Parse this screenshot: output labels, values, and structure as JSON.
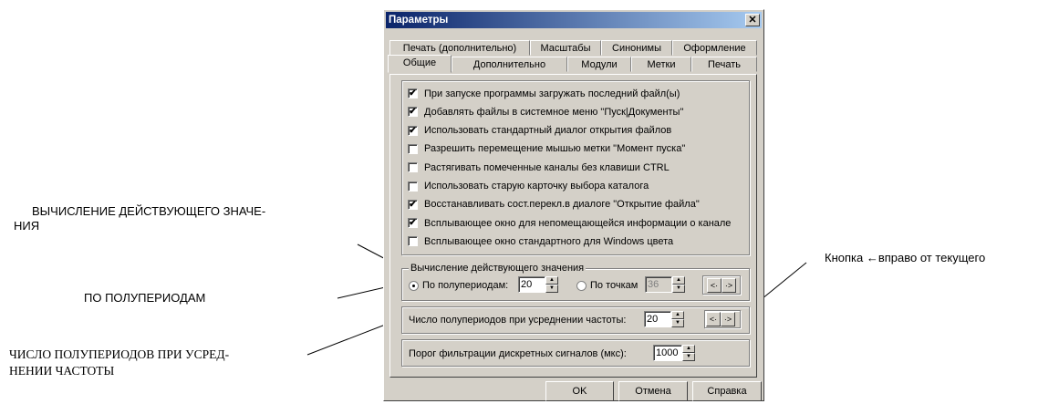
{
  "annotations": {
    "vych_line1": "ВЫЧИСЛЕНИЕ ДЕЙСТВУЮЩЕГО ЗНАЧЕ-",
    "vych_line2": "НИЯ",
    "po_poluperiodam": "ПО ПОЛУПЕРИОДАМ",
    "chislo_line1": "ЧИСЛО ПОЛУПЕРИОДОВ ПРИ УСРЕД-",
    "chislo_line2": "НЕНИИ ЧАСТОТЫ",
    "knopka": "Кнопка ←вправо от текущего"
  },
  "dialog": {
    "title": "Параметры",
    "close": "✕",
    "tabs_row1": [
      "Печать (дополнительно)",
      "Масштабы",
      "Синонимы",
      "Оформление"
    ],
    "tabs_row2": [
      "Общие",
      "Дополнительно",
      "Модули",
      "Метки",
      "Печать"
    ],
    "active_tab": "Общие",
    "checkboxes": [
      {
        "label": "При запуске программы загружать последний файл(ы)",
        "checked": true
      },
      {
        "label": "Добавлять файлы в системное меню \"Пуск|Документы\"",
        "checked": true
      },
      {
        "label": "Использовать стандартный диалог открытия файлов",
        "checked": true
      },
      {
        "label": "Разрешить перемещение мышью метки \"Момент пуска\"",
        "checked": false
      },
      {
        "label": "Растягивать помеченные каналы без клавиши CTRL",
        "checked": false
      },
      {
        "label": "Использовать старую карточку выбора каталога",
        "checked": false
      },
      {
        "label": "Восстанавливать сост.перекл.в диалоге \"Открытие файла\"",
        "checked": true
      },
      {
        "label": "Всплывающее окно для непомещающейся информации о канале",
        "checked": true
      },
      {
        "label": "Всплывающее окно стандартного для Windows цвета",
        "checked": false
      }
    ],
    "rms_group": {
      "title": "Вычисление действующего значения",
      "radio1_label": "По полупериодам:",
      "radio1_value": "20",
      "radio2_label": "По точкам",
      "radio2_value": "36",
      "btn_left": "<·",
      "btn_right": "·>"
    },
    "freq": {
      "label": "Число полупериодов при усреднении частоты:",
      "value": "20",
      "btn_left": "<·",
      "btn_right": "·>"
    },
    "filter": {
      "label": "Порог фильтрации дискретных сигналов (мкс):",
      "value": "1000"
    },
    "buttons": {
      "ok": "OK",
      "cancel": "Отмена",
      "help": "Справка"
    }
  }
}
